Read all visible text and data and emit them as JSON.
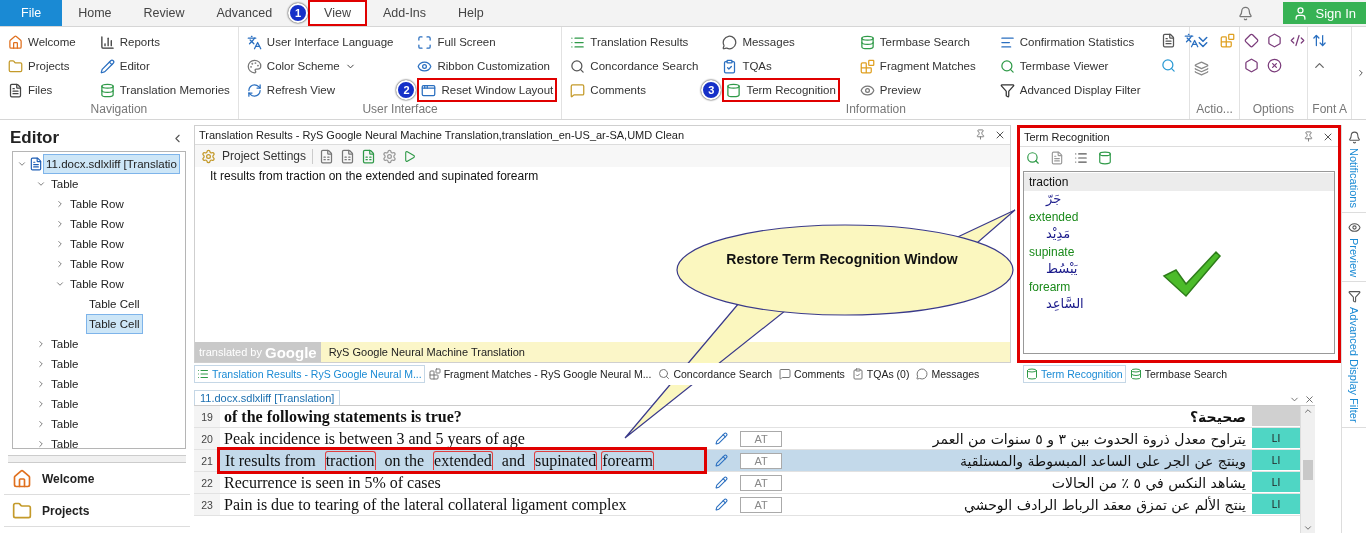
{
  "menu_tabs": [
    {
      "label": "File",
      "kind": "file",
      "selected": false
    },
    {
      "label": "Home",
      "kind": "tab",
      "selected": false
    },
    {
      "label": "Review",
      "kind": "tab",
      "selected": false
    },
    {
      "label": "Advanced",
      "kind": "tab",
      "selected": false
    },
    {
      "label": "View",
      "kind": "tab",
      "selected": true,
      "highlighted": true,
      "badge": "1"
    },
    {
      "label": "Add-Ins",
      "kind": "tab",
      "selected": false
    },
    {
      "label": "Help",
      "kind": "tab",
      "selected": false
    }
  ],
  "sign_in": "Sign In",
  "ribbon_groups": [
    {
      "title": "Navigation",
      "columns": [
        [
          {
            "label": "Welcome"
          },
          {
            "label": "Projects"
          },
          {
            "label": "Files"
          }
        ],
        [
          {
            "label": "Reports"
          },
          {
            "label": "Editor"
          },
          {
            "label": "Translation Memories"
          }
        ]
      ]
    },
    {
      "title": "User Interface",
      "columns": [
        [
          {
            "label": "User Interface Language"
          },
          {
            "label": "Color Scheme",
            "dropdown": true
          },
          {
            "label": "Refresh View"
          }
        ],
        [
          {
            "label": "Full Screen"
          },
          {
            "label": "Ribbon Customization"
          },
          {
            "label": "Reset Window Layout",
            "highlighted": true,
            "badge": "2"
          }
        ]
      ]
    },
    {
      "title": "Information",
      "columns": [
        [
          {
            "label": "Translation Results"
          },
          {
            "label": "Concordance Search"
          },
          {
            "label": "Comments"
          }
        ],
        [
          {
            "label": "Messages"
          },
          {
            "label": "TQAs"
          },
          {
            "label": "Term Recognition",
            "highlighted": true,
            "badge": "3"
          }
        ],
        [
          {
            "label": "Termbase Search"
          },
          {
            "label": "Fragment Matches"
          },
          {
            "label": "Preview"
          }
        ],
        [
          {
            "label": "Confirmation Statistics"
          },
          {
            "label": "Termbase Viewer"
          },
          {
            "label": "Advanced Display Filter"
          }
        ]
      ]
    },
    {
      "title": "Actio..."
    },
    {
      "title": "Options"
    },
    {
      "title": "Font A"
    }
  ],
  "editor_panel": {
    "title": "Editor",
    "tree": [
      {
        "label": "11.docx.sdlxliff [Translatio",
        "expanded": true,
        "selected": true,
        "children": [
          {
            "label": "Table",
            "expanded": true,
            "selected": false,
            "children": [
              {
                "label": "Table Row",
                "expanded": false,
                "selected": false
              },
              {
                "label": "Table Row",
                "expanded": false,
                "selected": false
              },
              {
                "label": "Table Row",
                "expanded": false,
                "selected": false
              },
              {
                "label": "Table Row",
                "expanded": false,
                "selected": false
              },
              {
                "label": "Table Row",
                "expanded": true,
                "selected": false,
                "children": [
                  {
                    "label": "Table Cell",
                    "selected": false
                  },
                  {
                    "label": "Table Cell",
                    "selected": true
                  }
                ]
              }
            ]
          },
          {
            "label": "Table",
            "expanded": false,
            "selected": false
          },
          {
            "label": "Table",
            "expanded": false,
            "selected": false
          },
          {
            "label": "Table",
            "expanded": false,
            "selected": false
          },
          {
            "label": "Table",
            "expanded": false,
            "selected": false
          },
          {
            "label": "Table",
            "expanded": false,
            "selected": false
          },
          {
            "label": "Table",
            "expanded": false,
            "selected": false
          }
        ]
      }
    ],
    "nav": [
      {
        "label": "Welcome"
      },
      {
        "label": "Projects"
      }
    ]
  },
  "results_panel": {
    "title": "Translation Results - RyS Google Neural Machine Translation,translation_en-US_ar-SA,UMD Clean",
    "toolbar_button": "Project Settings",
    "result": "It results from traction on the extended and supinated forearm",
    "provider_prefix": "translated by",
    "provider_brand": "Google",
    "provider": "RyS Google Neural Machine Translation"
  },
  "bottom_tabs": [
    {
      "label": "Translation Results - RyS Google Neural M...",
      "selected": true
    },
    {
      "label": "Fragment Matches - RyS Google Neural M...",
      "selected": false
    },
    {
      "label": "Concordance Search",
      "selected": false
    },
    {
      "label": "Comments",
      "selected": false
    },
    {
      "label": "TQAs (0)",
      "selected": false
    },
    {
      "label": "Messages",
      "selected": false
    }
  ],
  "term_panel": {
    "title": "Term Recognition",
    "highlighted": true,
    "terms": [
      {
        "source": "traction",
        "target": "جَرّ",
        "selected": true
      },
      {
        "source": "extended",
        "target": "مَدِيْد",
        "selected": false
      },
      {
        "source": "supinate",
        "target": "يَبْسُط",
        "selected": false
      },
      {
        "source": "forearm",
        "target": "السَّاعِد",
        "selected": false
      }
    ]
  },
  "term_tabs": [
    {
      "label": "Term Recognition",
      "selected": true
    },
    {
      "label": "Termbase Search",
      "selected": false
    }
  ],
  "document_tab": "11.docx.sdlxliff [Translation]",
  "segments": [
    {
      "number": "19",
      "source": "of the following statements is true?",
      "bold": true,
      "target": "صحيحة؟",
      "selected": false
    },
    {
      "number": "20",
      "source": "Peak incidence is between 3 and 5 years of age",
      "status": "AT",
      "target": "يتراوح معدل ذروة الحدوث بين ٣ و ٥ سنوات من العمر",
      "origin": "LI",
      "selected": false
    },
    {
      "number": "21",
      "parts": [
        {
          "text": "It results from ",
          "term": false
        },
        {
          "text": "traction",
          "term": true
        },
        {
          "text": " on the ",
          "term": false
        },
        {
          "text": "extended",
          "term": true
        },
        {
          "text": " and ",
          "term": false
        },
        {
          "text": "supinated",
          "term": true
        },
        {
          "text": "forearm",
          "term": true
        }
      ],
      "status": "AT",
      "target": "وينتج عن الجر على الساعد المبسوطة والمستلقية",
      "origin": "LI",
      "selected": true,
      "highlighted": true
    },
    {
      "number": "22",
      "source": "Recurrence is seen in 5% of cases",
      "status": "AT",
      "target": "يشاهد النكس في ٥ ٪ من الحالات",
      "origin": "LI",
      "selected": false
    },
    {
      "number": "23",
      "source": "Pain is due to tearing of the lateral collateral ligament complex",
      "status": "AT",
      "target": "ينتج الألم عن تمزق معقد الرباط الرادف الوحشي",
      "origin": "LI",
      "selected": false
    }
  ],
  "side_strip": [
    {
      "label": "Notifications"
    },
    {
      "label": "Preview"
    },
    {
      "label": "Advanced Display Filter"
    }
  ],
  "callout": "Restore Term Recognition Window"
}
